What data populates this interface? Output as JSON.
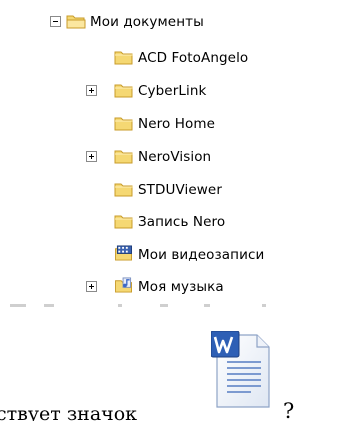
{
  "tree": {
    "root": {
      "label": "Мои документы",
      "expander": "minus",
      "icon": "folder-icon"
    },
    "items": [
      {
        "label": "ACD FotoAngelo",
        "expander": "",
        "icon": "folder-icon"
      },
      {
        "label": "CyberLink",
        "expander": "plus",
        "icon": "folder-icon"
      },
      {
        "label": "Nero Home",
        "expander": "",
        "icon": "folder-icon"
      },
      {
        "label": "NeroVision",
        "expander": "plus",
        "icon": "folder-icon"
      },
      {
        "label": "STDUViewer",
        "expander": "",
        "icon": "folder-icon"
      },
      {
        "label": "Запись Nero",
        "expander": "",
        "icon": "folder-icon"
      },
      {
        "label": "Мои видеозаписи",
        "expander": "",
        "icon": "video-folder-icon"
      },
      {
        "label": "Моя музыка",
        "expander": "plus",
        "icon": "music-folder-icon"
      }
    ]
  },
  "question": {
    "text": "ствует значок",
    "suffix": "?"
  },
  "colors": {
    "folder_body": "#f5d873",
    "folder_edge": "#c89b2a",
    "word_blue": "#2e5fb5"
  }
}
